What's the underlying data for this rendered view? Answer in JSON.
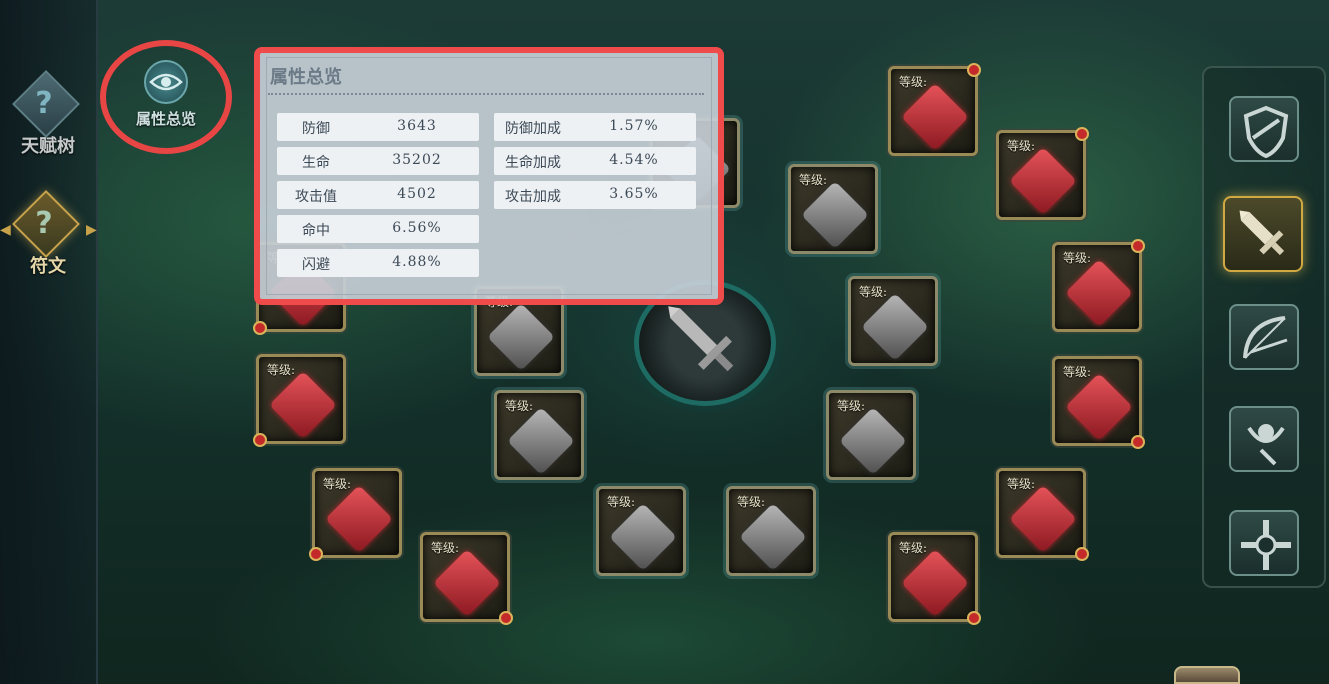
{
  "nav": {
    "items": [
      {
        "label": "天赋树",
        "icon": "question-mark-icon",
        "active": false
      },
      {
        "label": "符文",
        "icon": "question-mark-icon",
        "active": true
      }
    ]
  },
  "attr_button": {
    "label": "属性总览",
    "icon": "eye-icon"
  },
  "panel": {
    "title": "属性总览",
    "stats_left": [
      {
        "label": "防御",
        "value": "3643"
      },
      {
        "label": "生命",
        "value": "35202"
      },
      {
        "label": "攻击值",
        "value": "4502"
      },
      {
        "label": "命中",
        "value": "6.56%"
      },
      {
        "label": "闪避",
        "value": "4.88%"
      }
    ],
    "stats_right": [
      {
        "label": "防御加成",
        "value": "1.57%"
      },
      {
        "label": "生命加成",
        "value": "4.54%"
      },
      {
        "label": "攻击加成",
        "value": "3.65%"
      }
    ]
  },
  "slot_level_label": "等级:",
  "slots": {
    "red": {
      "gem": "red-rune-gem-icon"
    },
    "grey": {
      "gem": "grey-rune-gem-icon"
    }
  },
  "center": {
    "icon": "sword-icon"
  },
  "tools": [
    {
      "icon": "shield-icon",
      "active": false
    },
    {
      "icon": "sword-icon",
      "active": true
    },
    {
      "icon": "bow-icon",
      "active": false
    },
    {
      "icon": "crescent-orb-icon",
      "active": false
    },
    {
      "icon": "cross-icon",
      "active": false
    }
  ],
  "colors": {
    "highlight_red": "#ef4b4b",
    "gold": "#d1a943",
    "teal": "#1d6b62"
  }
}
